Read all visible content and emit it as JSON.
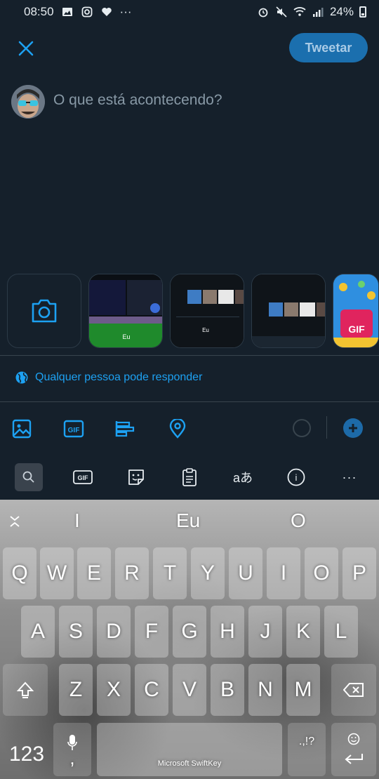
{
  "status_bar": {
    "time": "08:50",
    "more": "···",
    "battery": "24%",
    "left_icons": [
      "image-icon",
      "instagram-icon",
      "heart-icon"
    ],
    "right_icons": [
      "alarm-icon",
      "mute-icon",
      "wifi-icon",
      "signal-icon",
      "battery-icon"
    ]
  },
  "compose": {
    "tweet_button": "Tweetar",
    "placeholder": "O que está acontecendo?",
    "reply_setting": "Qualquer pessoa pode responder",
    "gif_badge": "GIF"
  },
  "toolbar": {
    "gif_label": "GIF"
  },
  "keyboard": {
    "toolbar": {
      "gif_label": "GIF",
      "translate_label": "aあ",
      "info_label": "i",
      "more_label": "···"
    },
    "suggestions": [
      "I",
      "Eu",
      "O"
    ],
    "rows": [
      [
        "Q",
        "W",
        "E",
        "R",
        "T",
        "Y",
        "U",
        "I",
        "O",
        "P"
      ],
      [
        "A",
        "S",
        "D",
        "F",
        "G",
        "H",
        "J",
        "K",
        "L"
      ],
      [
        "Z",
        "X",
        "C",
        "V",
        "B",
        "N",
        "M"
      ]
    ],
    "numbers_key": "123",
    "comma_key": ",",
    "punctuation_key": ".,!?",
    "space_label": "Microsoft SwiftKey"
  },
  "colors": {
    "background": "#15202b",
    "accent": "#1da1f2",
    "tweet_button_bg": "#1b6fae"
  }
}
